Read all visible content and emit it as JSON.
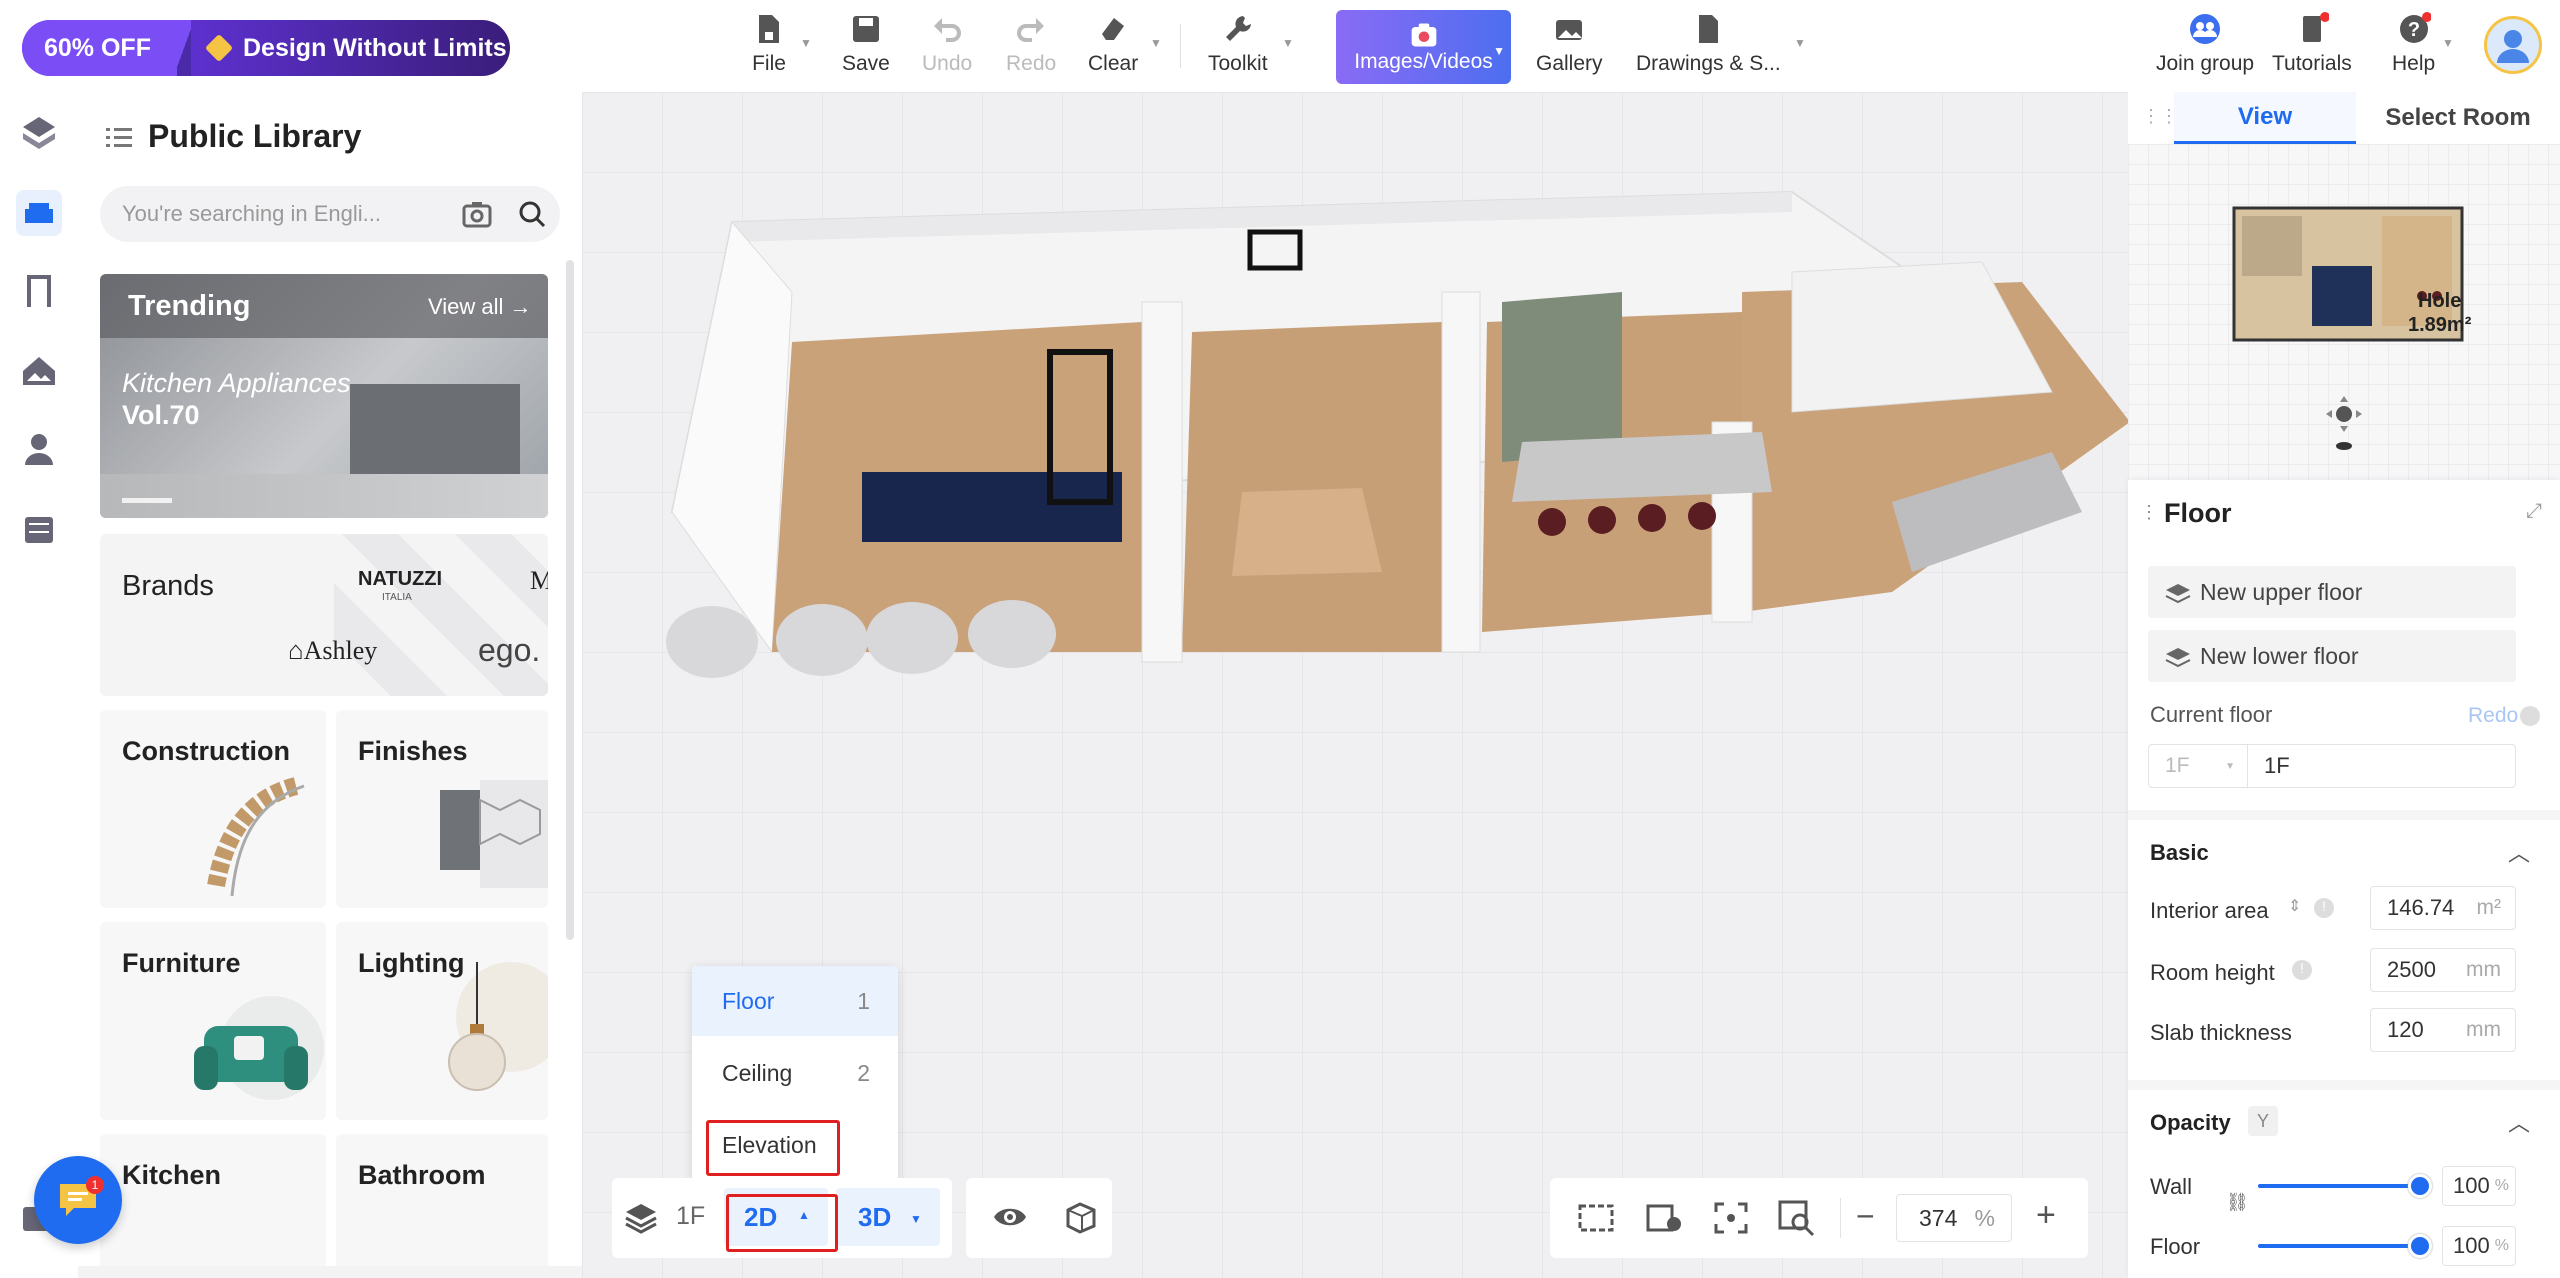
{
  "promo": {
    "discount": "60% OFF",
    "tagline": "Design Without Limits"
  },
  "toolbar": {
    "file": "File",
    "save": "Save",
    "undo": "Undo",
    "redo": "Redo",
    "clear": "Clear",
    "toolkit": "Toolkit",
    "images_videos": "Images/Videos",
    "gallery": "Gallery",
    "drawings": "Drawings & S...",
    "join_group": "Join group",
    "tutorials": "Tutorials",
    "help": "Help"
  },
  "library": {
    "title": "Public Library",
    "search_placeholder": "You're searching in Engli...",
    "trending": {
      "label": "Trending",
      "view_all": "View all",
      "banner_title": "Kitchen Appliances",
      "banner_vol": "Vol.70"
    },
    "brands": {
      "label": "Brands",
      "logos": [
        "NATUZZI",
        "ITALIA",
        "Ashley",
        "ego."
      ]
    },
    "categories": [
      "Construction",
      "Finishes",
      "Furniture",
      "Lighting",
      "Kitchen",
      "Bathroom"
    ]
  },
  "view_tabs": {
    "view": "View",
    "select_room": "Select Room"
  },
  "minimap": {
    "hole_label": "Hole",
    "hole_area": "1.89m²"
  },
  "floor_panel": {
    "title": "Floor",
    "new_upper": "New upper floor",
    "new_lower": "New lower floor",
    "current_floor_label": "Current floor",
    "redo": "Redo",
    "floor_select": "1F",
    "floor_name": "1F",
    "basic": "Basic",
    "interior_area_label": "Interior area",
    "interior_area_value": "146.74",
    "interior_area_unit": "m²",
    "room_height_label": "Room height",
    "room_height_value": "2500",
    "room_height_unit": "mm",
    "slab_label": "Slab thickness",
    "slab_value": "120",
    "slab_unit": "mm",
    "opacity": "Opacity",
    "opacity_key": "Y",
    "wall_label": "Wall",
    "wall_value": "100",
    "floor_label": "Floor",
    "floor_value": "100",
    "pct": "%"
  },
  "bottom": {
    "floor_btn": "1F",
    "btn_2d": "2D",
    "btn_3d": "3D",
    "zoom": "374",
    "zoom_unit": "%",
    "menu": [
      {
        "label": "Floor",
        "key": "1"
      },
      {
        "label": "Ceiling",
        "key": "2"
      },
      {
        "label": "Elevation",
        "key": ""
      }
    ]
  },
  "chat_badge": "1",
  "colors": {
    "accent": "#1f6cf0",
    "highlight": "#e02020",
    "promo": "#6a3df0"
  }
}
